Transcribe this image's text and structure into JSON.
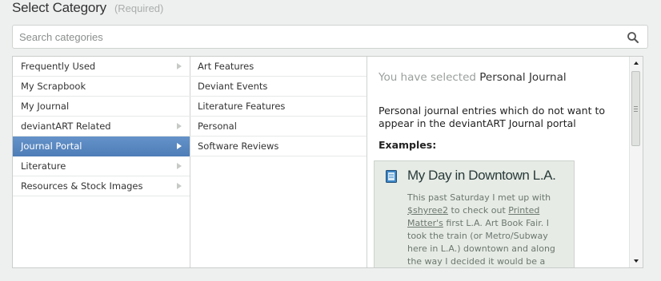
{
  "header": {
    "title": "Select Category",
    "required": "(Required)"
  },
  "search": {
    "placeholder": "Search categories",
    "value": ""
  },
  "categories": [
    {
      "label": "Frequently Used",
      "has_children": true
    },
    {
      "label": "My Scrapbook",
      "has_children": false
    },
    {
      "label": "My Journal",
      "has_children": false
    },
    {
      "label": "deviantART Related",
      "has_children": true
    },
    {
      "label": "Journal Portal",
      "has_children": true,
      "active": true
    },
    {
      "label": "Literature",
      "has_children": true
    },
    {
      "label": "Resources & Stock Images",
      "has_children": true
    }
  ],
  "subcategories": [
    {
      "label": "Art Features"
    },
    {
      "label": "Deviant Events"
    },
    {
      "label": "Literature Features"
    },
    {
      "label": "Personal"
    },
    {
      "label": "Software Reviews"
    }
  ],
  "detail": {
    "selected_prefix": "You have selected",
    "selected_name": "Personal Journal",
    "description": "Personal journal entries which do not want to appear in the deviantART Journal portal",
    "examples_label": "Examples:",
    "example": {
      "title": "My Day in Downtown L.A.",
      "body_1": "This past Saturday I met up with",
      "mention": "$shyree2",
      "body_2": " to check out ",
      "link_1": "Printed",
      "link_2": "Matter's",
      "body_3": " first L.A. Art Book Fair. I took the train (or Metro/Subway here in L.A.) downtown and along the way I decided it would be a"
    }
  },
  "colors": {
    "active_item": "#5b88c0",
    "card_bg": "#e6ebe5",
    "page_bg": "#eef0ef"
  }
}
